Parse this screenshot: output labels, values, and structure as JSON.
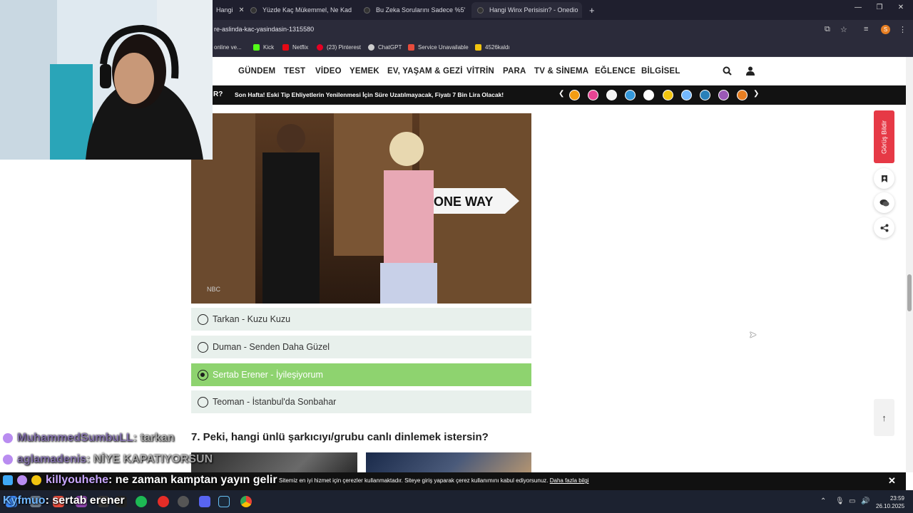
{
  "browser": {
    "tabs": [
      {
        "title": "Hangi"
      },
      {
        "title": "Yüzde Kaç Mükemmel, Ne Kad"
      },
      {
        "title": "Bu Zeka Sorularını Sadece %5'"
      },
      {
        "title": "Hangi Winx Perisisin? - Onedio"
      }
    ],
    "new_tab": "+",
    "url": "re-aslinda-kac-yasindasin-1315580",
    "profile_initial": "S",
    "bookmarks": [
      {
        "label": "online ve...",
        "color": "#888888"
      },
      {
        "label": "Kick",
        "color": "#53fc18"
      },
      {
        "label": "Netflix",
        "color": "#e50914"
      },
      {
        "label": "(23) Pinterest",
        "color": "#e60023"
      },
      {
        "label": "ChatGPT",
        "color": "#cccccc"
      },
      {
        "label": "Service Unavailable",
        "color": "#e74c3c"
      },
      {
        "label": "4526kaldı",
        "color": "#f1c40f"
      }
    ]
  },
  "site": {
    "nav": [
      "GÜNDEM",
      "TEST",
      "VİDEO",
      "YEMEK",
      "EV, YAŞAM & GEZİ",
      "VİTRİN",
      "PARA",
      "TV & SİNEMA",
      "EĞLENCE",
      "BİLGİSEL"
    ],
    "news_prefix": "R?",
    "news_headline": "Son Hafta! Eski Tip Ehliyetlerin Yenilenmesi İçin Süre Uzatılmayacak, Fiyatı 7 Bin Lira Olacak!",
    "gif_watermark": "NBC",
    "gif_sign": "ONE WAY"
  },
  "quiz": {
    "options": [
      {
        "label": "Tarkan - Kuzu Kuzu",
        "selected": false
      },
      {
        "label": "Duman - Senden Daha Güzel",
        "selected": false
      },
      {
        "label": "Sertab Erener - İyileşiyorum",
        "selected": true
      },
      {
        "label": "Teoman - İstanbul'da Sonbahar",
        "selected": false
      }
    ],
    "next_question": "7. Peki, hangi ünlü şarkıcıyı/grubu canlı dinlemek istersin?"
  },
  "rail": {
    "feedback_label": "Görüş Bildir"
  },
  "chat": [
    {
      "user": "MuhammedSumbuLL",
      "message": ": tarkan",
      "faded": true
    },
    {
      "user": "aglamadenis",
      "message": ": NİYE KAPATIYORSUN",
      "faded": true
    },
    {
      "user": "killyouhehe",
      "message": ": ne zaman kamptan yayın gelir",
      "faded": false
    },
    {
      "user": "Kyfmuo",
      "message": ": sertab erener",
      "faded": false
    }
  ],
  "cookie": {
    "text": "Sitemiz en iyi hizmet için çerezler kullanmaktadır. Siteye giriş yaparak çerez kullanımını kabul ediyorsunuz.",
    "link": "Daha fazla bilgi"
  },
  "taskbar": {
    "time": "23:59",
    "date": "26.10.2025"
  }
}
